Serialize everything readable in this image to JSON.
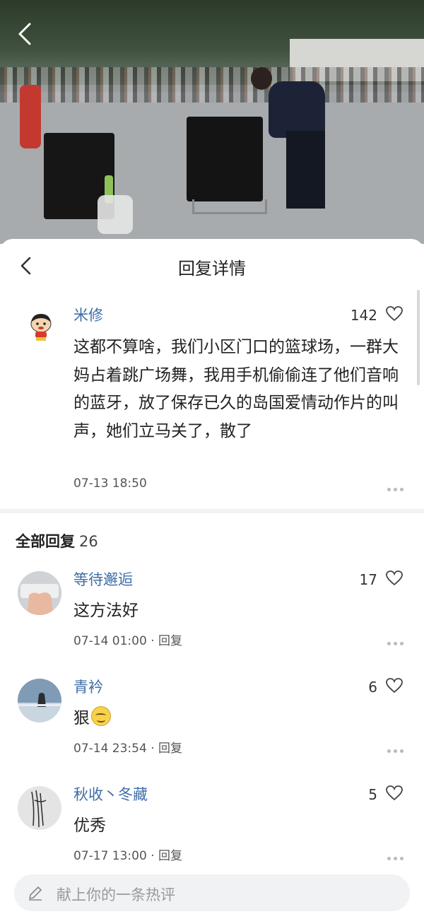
{
  "page": {
    "title": "回复详情"
  },
  "main_comment": {
    "username": "米修",
    "likes": "142",
    "content": "这都不算啥，我们小区门口的篮球场，一群大妈占着跳广场舞，我用手机偷偷连了他们音响的蓝牙，放了保存已久的岛国爱情动作片的叫声，她们立马关了，散了",
    "time": "07-13 18:50"
  },
  "replies_header": {
    "label": "全部回复",
    "count": "26"
  },
  "replies": [
    {
      "username": "等待邂逅",
      "likes": "17",
      "text": "这方法好",
      "time": "07-14 01:00 · 回复"
    },
    {
      "username": "青衿",
      "likes": "6",
      "text": "狠",
      "emoji": "grin-emoji",
      "time": "07-14 23:54 · 回复"
    },
    {
      "username": "秋收丶冬藏",
      "likes": "5",
      "text": "优秀",
      "time": "07-17 13:00 · 回复"
    }
  ],
  "input": {
    "placeholder": "献上你的一条热评"
  },
  "colors": {
    "username": "#3e6ea8",
    "text": "#222222",
    "meta": "#555555",
    "divider": "#f2f2f2",
    "input_bg": "#f1f2f4"
  },
  "icons": [
    "back-icon",
    "heart-icon",
    "more-icon",
    "pencil-icon"
  ]
}
